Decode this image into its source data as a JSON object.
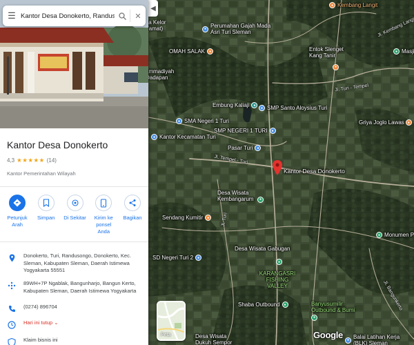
{
  "search": {
    "query": "Kantor Desa Donokerto, Randuso"
  },
  "place": {
    "name": "Kantor Desa Donokerto",
    "rating": "4,3",
    "stars": "★★★★★",
    "review_count": "(14)",
    "category": "Kantor Pemerintahan Wilayah"
  },
  "actions": [
    {
      "label": "Petunjuk Arah",
      "icon": "directions-icon"
    },
    {
      "label": "Simpan",
      "icon": "bookmark-icon"
    },
    {
      "label": "Di Sekitar",
      "icon": "nearby-icon"
    },
    {
      "label": "Kirim ke ponsel Anda",
      "icon": "send-to-phone-icon"
    },
    {
      "label": "Bagikan",
      "icon": "share-icon"
    }
  ],
  "info": {
    "address": "Donokerto, Turi, Randusongo, Donokerto, Kec. Sleman, Kabupaten Sleman, Daerah Istimewa Yogyakarta 55551",
    "plus_code": "89WH+7P Ngablak, Bangunharjo, Bangun Kerto, Kabupaten Sleman, Daerah Istimewa Yogyakarta",
    "phone": "(0274) 896704",
    "hours": "Hari ini tutup",
    "claim": "Klaim bisnis ini"
  },
  "map": {
    "selected_place": "Kantor Desa Donokerto",
    "layer_toggle_label": "Peta",
    "google_logo": "Google",
    "places": [
      {
        "name": "Kembang Langit",
        "color": "orange"
      },
      {
        "name": "Perumahan Gajah Mada Asri Turi Sleman",
        "color": "blue"
      },
      {
        "name": "ta Kelor (amat)",
        "color": "blue"
      },
      {
        "name": "OMAH SALAK",
        "color": "orange"
      },
      {
        "name": "Entok Slenget Kang Tanir",
        "color": "orange"
      },
      {
        "name": "Masjid",
        "color": "green"
      },
      {
        "name": "ammadiyah Dadapan",
        "color": "blue"
      },
      {
        "name": "Embung Kaliaji",
        "color": "green"
      },
      {
        "name": "SMP Santo Aloysius Turi",
        "color": "blue"
      },
      {
        "name": "SMA Negeri 1 Turi",
        "color": "blue"
      },
      {
        "name": "SMP NEGERI 1 TURI",
        "color": "blue"
      },
      {
        "name": "Griya Joglo Lawas",
        "color": "orange"
      },
      {
        "name": "Kantor Kecamatan Turi",
        "color": "blue"
      },
      {
        "name": "Pasar Turi",
        "color": "blue"
      },
      {
        "name": "Desa Wisata Kembangarum",
        "color": "green"
      },
      {
        "name": "Sendang Kumitir",
        "color": "orange"
      },
      {
        "name": "Monumen P",
        "color": "green"
      },
      {
        "name": "Desa Wisata Gabugan",
        "color": "green"
      },
      {
        "name": "SD Negeri Turi 2",
        "color": "blue"
      },
      {
        "name": "KARANGASRI FISHING VALLEY",
        "color": "green"
      },
      {
        "name": "Shaba Outbound",
        "color": "green"
      },
      {
        "name": "Banyusumilir Outbound & Bumi",
        "color": "green"
      },
      {
        "name": "Desa Wisata Dukuh Sempor",
        "color": "orange"
      },
      {
        "name": "Balai Latihan Kerja (BLK) Sleman",
        "color": "blue"
      }
    ],
    "roads": [
      "Jl. Tempel - Turi",
      "Jl. Turi",
      "Jl. Kembang Langit",
      "Jl. Turi - Tempel",
      "Jl. Bangunkerto"
    ]
  }
}
